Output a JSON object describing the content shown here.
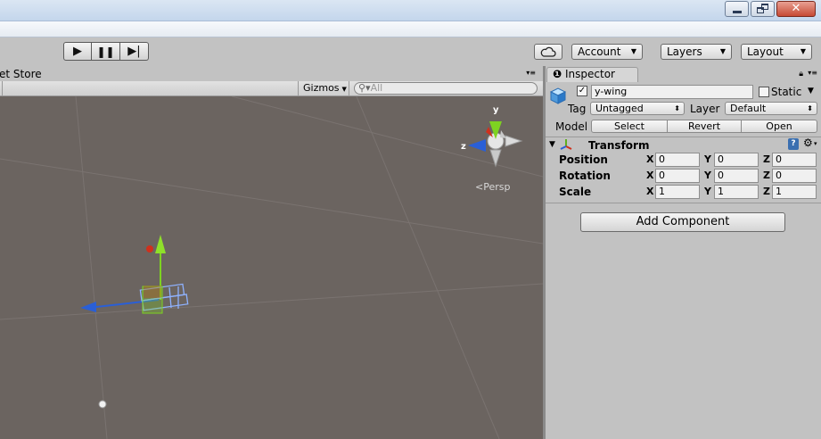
{
  "toolbar": {
    "play_icon": "play-icon",
    "pause_icon": "pause-icon",
    "step_icon": "step-icon",
    "cloud_icon": "cloud-icon",
    "account_label": "Account",
    "layers_label": "Layers",
    "layout_label": "Layout"
  },
  "scene": {
    "tab_label": "et Store",
    "gizmos_label": "Gizmos",
    "search_placeholder": "All",
    "persp_label": "Persp",
    "axis_y": "y",
    "axis_z": "z"
  },
  "inspector": {
    "tab_label": "Inspector",
    "object_name": "y-wing",
    "static_label": "Static",
    "tag_label": "Tag",
    "tag_value": "Untagged",
    "layer_label": "Layer",
    "layer_value": "Default",
    "model_label": "Model",
    "model_buttons": [
      "Select",
      "Revert",
      "Open"
    ],
    "transform_title": "Transform",
    "rows": [
      {
        "label": "Position",
        "x": "0",
        "y": "0",
        "z": "0"
      },
      {
        "label": "Rotation",
        "x": "0",
        "y": "0",
        "z": "0"
      },
      {
        "label": "Scale",
        "x": "1",
        "y": "1",
        "z": "1"
      }
    ],
    "axis_labels": [
      "X",
      "Y",
      "Z"
    ],
    "add_component_label": "Add Component"
  },
  "colors": {
    "scene_bg": "#6b6460",
    "panel_bg": "#c2c2c2",
    "gizmo_y": "#7ed321",
    "gizmo_x": "#d0301c",
    "gizmo_z": "#2a5fd6"
  }
}
